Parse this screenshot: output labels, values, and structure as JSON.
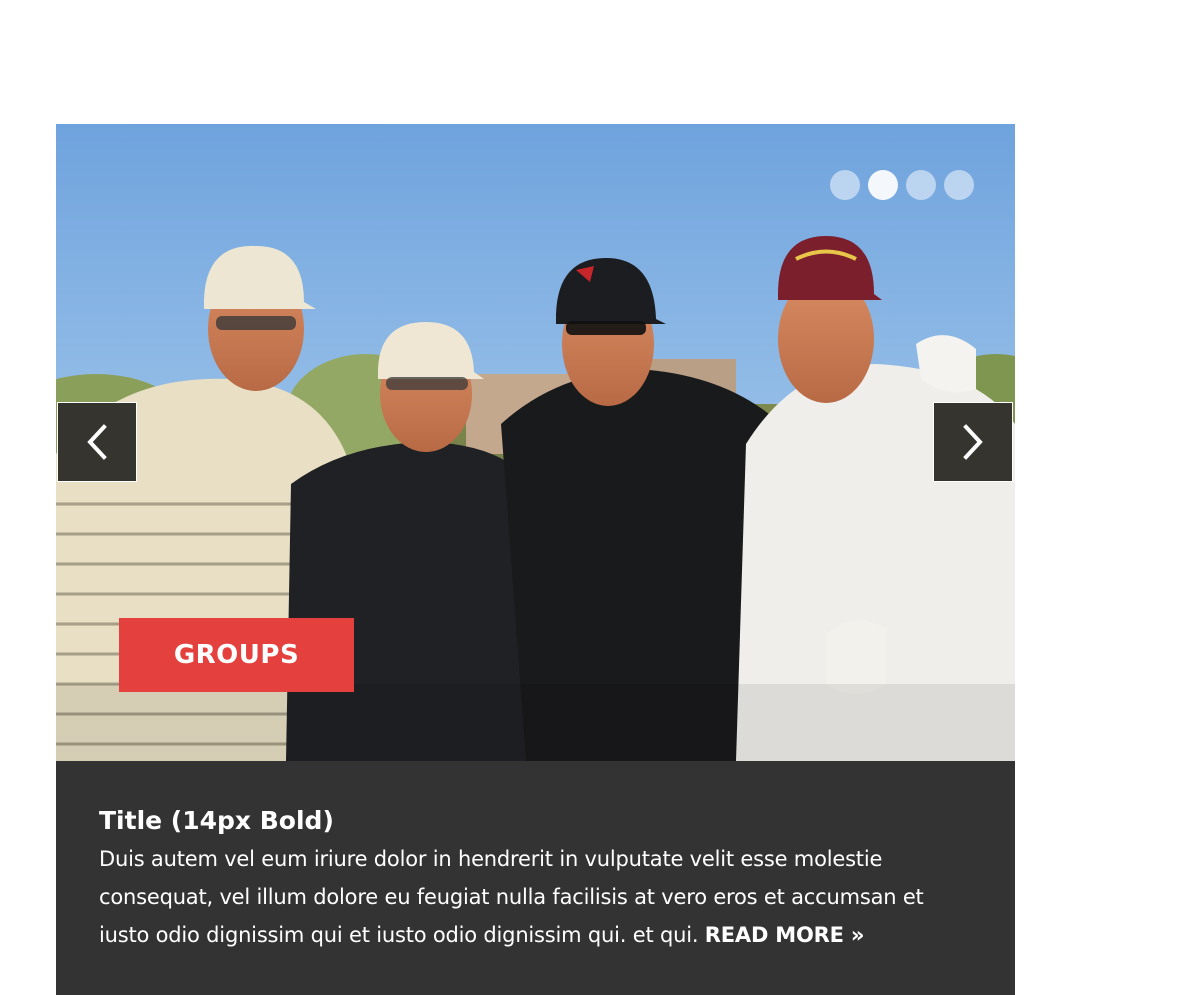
{
  "slider": {
    "dots_count": 4,
    "active_dot": 1,
    "tag_label": "GROUPS",
    "tag_color": "#e3403e",
    "caption": {
      "title": "Title (14px Bold)",
      "body": "Duis autem vel eum iriure dolor in hendrerit in vulputate velit esse molestie consequat, vel illum dolore eu feugiat nulla facilisis at vero eros et accumsan et iusto odio dignissim qui et iusto odio dignissim qui. et qui.",
      "read_more": "READ MORE",
      "read_more_icon": "double-chevron-right-icon"
    },
    "prev_icon": "chevron-left-icon",
    "next_icon": "chevron-right-icon",
    "photo_description_icon": "golfers-photo"
  }
}
